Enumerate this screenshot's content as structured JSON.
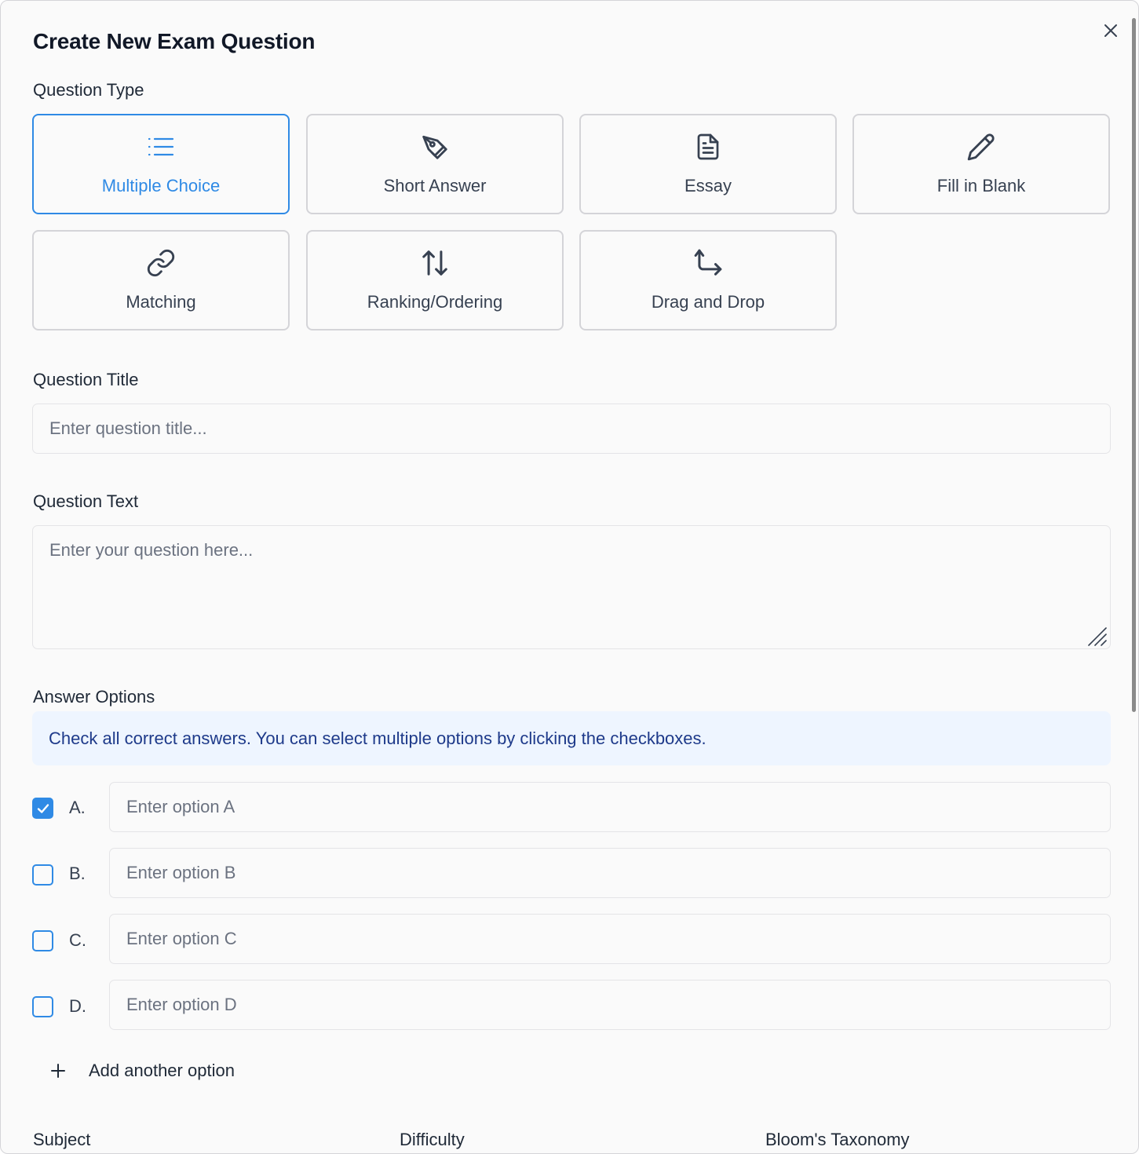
{
  "dialog": {
    "title": "Create New Exam Question",
    "close_icon": "close-icon"
  },
  "question_type": {
    "label": "Question Type",
    "selected": "Multiple Choice",
    "options": [
      {
        "label": "Multiple Choice",
        "icon": "list-icon"
      },
      {
        "label": "Short Answer",
        "icon": "pen-tool-icon"
      },
      {
        "label": "Essay",
        "icon": "document-icon"
      },
      {
        "label": "Fill in Blank",
        "icon": "pencil-icon"
      },
      {
        "label": "Matching",
        "icon": "link-icon"
      },
      {
        "label": "Ranking/Ordering",
        "icon": "sort-arrows-icon"
      },
      {
        "label": "Drag and Drop",
        "icon": "drag-move-icon"
      }
    ]
  },
  "question_title": {
    "label": "Question Title",
    "placeholder": "Enter question title...",
    "value": ""
  },
  "question_text": {
    "label": "Question Text",
    "placeholder": "Enter your question here...",
    "value": ""
  },
  "answer_options": {
    "label": "Answer Options",
    "hint": "Check all correct answers. You can select multiple options by clicking the checkboxes.",
    "items": [
      {
        "letter": "A.",
        "placeholder": "Enter option A",
        "checked": true
      },
      {
        "letter": "B.",
        "placeholder": "Enter option B",
        "checked": false
      },
      {
        "letter": "C.",
        "placeholder": "Enter option C",
        "checked": false
      },
      {
        "letter": "D.",
        "placeholder": "Enter option D",
        "checked": false
      }
    ],
    "add_label": "Add another option"
  },
  "metadata_labels": {
    "subject": "Subject",
    "difficulty": "Difficulty",
    "blooms": "Bloom's Taxonomy"
  },
  "colors": {
    "accent": "#2f8ae5",
    "info_bg": "#eef5ff",
    "info_text": "#1e3a8a"
  }
}
